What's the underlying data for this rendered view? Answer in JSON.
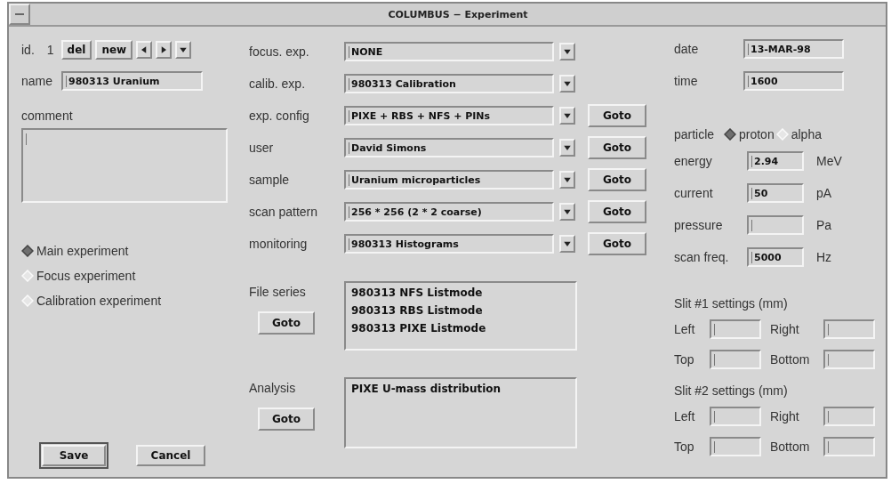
{
  "window": {
    "title": "COLUMBUS − Experiment"
  },
  "record": {
    "id_label": "id.",
    "id_value": "1",
    "buttons": [
      "del",
      "new"
    ]
  },
  "name": {
    "label": "name",
    "value": "980313 Uranium"
  },
  "comment": {
    "label": "comment"
  },
  "experiment_type": [
    {
      "label": "Main experiment",
      "selected": true
    },
    {
      "label": "Focus experiment",
      "selected": false
    },
    {
      "label": "Calibration experiment",
      "selected": false
    }
  ],
  "actions": [
    {
      "label": "Save",
      "default": true
    },
    {
      "label": "Cancel",
      "default": false
    }
  ],
  "links": [
    {
      "label": "focus. exp.",
      "value": "NONE"
    },
    {
      "label": "calib. exp.",
      "value": "980313 Calibration"
    },
    {
      "label": "exp. config",
      "value": "PIXE + RBS + NFS + PINs",
      "goto": "Goto"
    },
    {
      "label": "user",
      "value": "David Simons",
      "goto": "Goto"
    },
    {
      "label": "sample",
      "value": "Uranium microparticles",
      "goto": "Goto"
    },
    {
      "label": "scan pattern",
      "value": "256 * 256 (2 * 2 coarse)",
      "goto": "Goto"
    },
    {
      "label": "monitoring",
      "value": "980313 Histograms",
      "goto": "Goto"
    }
  ],
  "file_series": {
    "label": "File series",
    "button": "Goto",
    "items": [
      "980313 NFS Listmode",
      "980313 RBS Listmode",
      "980313 PIXE Listmode"
    ]
  },
  "analysis": {
    "label": "Analysis",
    "button": "Goto",
    "items": [
      "PIXE U-mass distribution"
    ]
  },
  "date": {
    "label": "date",
    "value": "13-MAR-98"
  },
  "time": {
    "label": "time",
    "value": "1600"
  },
  "particle": {
    "label": "particle",
    "options": [
      {
        "label": "proton",
        "selected": true
      },
      {
        "label": "alpha",
        "selected": false
      }
    ]
  },
  "measurements": [
    {
      "label": "energy",
      "value": "2.94",
      "unit": "MeV"
    },
    {
      "label": "current",
      "value": "50",
      "unit": "pA"
    },
    {
      "label": "pressure",
      "unit": "Pa"
    },
    {
      "label": "scan freq.",
      "value": "5000",
      "unit": "Hz"
    }
  ],
  "slits": [
    {
      "title": "Slit #1 settings (mm)",
      "fields": [
        {
          "label": "Left"
        },
        {
          "label": "Right"
        },
        {
          "label": "Top"
        },
        {
          "label": "Bottom"
        }
      ]
    },
    {
      "title": "Slit #2 settings (mm)",
      "fields": [
        {
          "label": "Left"
        },
        {
          "label": "Right"
        },
        {
          "label": "Top"
        },
        {
          "label": "Bottom"
        }
      ]
    }
  ]
}
